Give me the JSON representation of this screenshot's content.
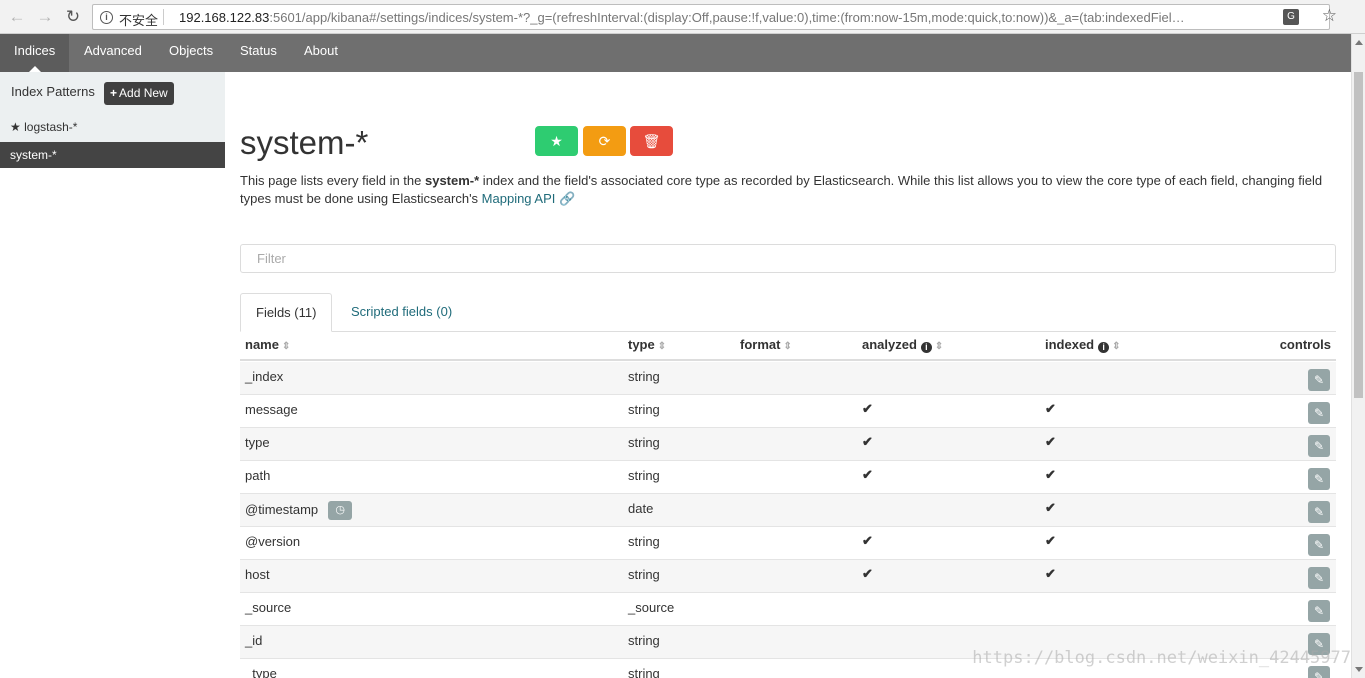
{
  "browser": {
    "security_label": "不安全",
    "url_host": "192.168.122.83",
    "url_rest": ":5601/app/kibana#/settings/indices/system-*?_g=(refreshInterval:(display:Off,pause:!f,value:0),time:(from:now-15m,mode:quick,to:now))&_a=(tab:indexedFiel…"
  },
  "nav": {
    "tabs": [
      {
        "label": "Indices",
        "active": true
      },
      {
        "label": "Advanced"
      },
      {
        "label": "Objects"
      },
      {
        "label": "Status"
      },
      {
        "label": "About"
      }
    ]
  },
  "sidebar": {
    "title": "Index Patterns",
    "add_new_label": "Add New",
    "patterns": [
      {
        "label": "logstash-*",
        "default": true
      },
      {
        "label": "system-*",
        "selected": true
      }
    ]
  },
  "main": {
    "title": "system-*",
    "desc_pre": "This page lists every field in the ",
    "desc_bold": "system-*",
    "desc_post": " index and the field's associated core type as recorded by Elasticsearch. While this list allows you to view the core type of each field, changing field types must be done using Elasticsearch's ",
    "mapping_link": "Mapping API",
    "filter_placeholder": "Filter",
    "tabs": [
      {
        "label": "Fields (11)",
        "active": true
      },
      {
        "label": "Scripted fields (0)"
      }
    ],
    "columns": {
      "name": "name",
      "type": "type",
      "format": "format",
      "analyzed": "analyzed",
      "indexed": "indexed",
      "controls": "controls"
    },
    "rows": [
      {
        "name": "_index",
        "type": "string",
        "analyzed": false,
        "indexed": false
      },
      {
        "name": "message",
        "type": "string",
        "analyzed": true,
        "indexed": true
      },
      {
        "name": "type",
        "type": "string",
        "analyzed": true,
        "indexed": true
      },
      {
        "name": "path",
        "type": "string",
        "analyzed": true,
        "indexed": true
      },
      {
        "name": "@timestamp",
        "type": "date",
        "analyzed": false,
        "indexed": true,
        "time_field": true
      },
      {
        "name": "@version",
        "type": "string",
        "analyzed": true,
        "indexed": true
      },
      {
        "name": "host",
        "type": "string",
        "analyzed": true,
        "indexed": true
      },
      {
        "name": "_source",
        "type": "_source",
        "analyzed": false,
        "indexed": false
      },
      {
        "name": "_id",
        "type": "string",
        "analyzed": false,
        "indexed": false
      },
      {
        "name": "_type",
        "type": "string",
        "analyzed": false,
        "indexed": false
      }
    ]
  },
  "watermark": "https://blog.csdn.net/weixin_42445977",
  "colors": {
    "nav_bg": "#6f6f6f",
    "green": "#2ecc71",
    "orange": "#f39c12",
    "red": "#e74c3c",
    "link": "#1f6b7a",
    "edit_btn": "#95a5a6"
  }
}
